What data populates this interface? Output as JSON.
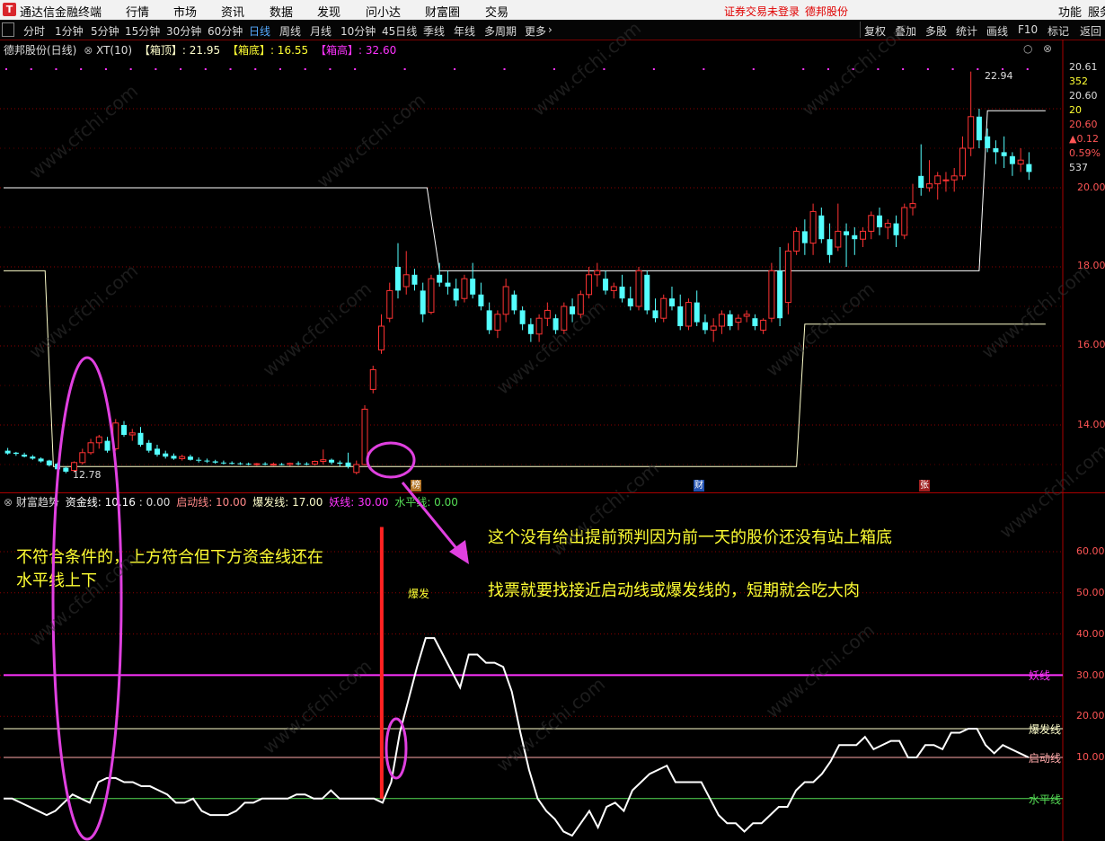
{
  "menu": {
    "app_title": "通达信金融终端",
    "items": [
      "行情",
      "市场",
      "资讯",
      "数据",
      "发现",
      "问小达",
      "财富圈",
      "交易"
    ],
    "login_status": "证券交易未登录",
    "stock_name": "德邦股份",
    "right_items": [
      "功能",
      "服务"
    ]
  },
  "toolbar": {
    "periods": [
      "分时",
      "1分钟",
      "5分钟",
      "15分钟",
      "30分钟",
      "60分钟",
      "日线",
      "周线",
      "月线",
      "10分钟",
      "45日线",
      "季线",
      "年线",
      "多周期",
      "更多"
    ],
    "active_period": "日线",
    "tools": [
      "复权",
      "叠加",
      "多股",
      "统计",
      "画线",
      "F10",
      "标记",
      "返回"
    ]
  },
  "main_panel": {
    "title": "德邦股份(日线)",
    "indicator_name": "XT(10)",
    "box_top_label": "【箱顶】: 21.95",
    "box_bottom_label": "【箱底】: 16.55",
    "box_high_label": "【箱高】: 32.60",
    "low_marker": "12.78",
    "high_marker": "22.94",
    "event_markers": [
      "榜",
      "财",
      "张"
    ],
    "y_axis_ticks": [
      "14.00",
      "16.00",
      "18.00",
      "20.00"
    ],
    "right_readouts": [
      "20.61",
      "352",
      "20.60",
      "20",
      "20.60",
      "▲0.12",
      "0.59%",
      "537"
    ]
  },
  "sub_panel": {
    "title": "财富趋势",
    "money_line_label": "资金线: 10.16",
    "extra_value": ": 0.00",
    "start_line_label": "启动线: 10.00",
    "burst_line_label": "爆发线: 17.00",
    "demon_line_label": "妖线: 30.00",
    "level_line_label": "水平线: 0.00",
    "y_axis_ticks": [
      "10.00",
      "20.00",
      "30.00",
      "40.00",
      "50.00",
      "60.00"
    ],
    "line_tags": {
      "demon": "妖线",
      "burst": "爆发线",
      "start": "启动线",
      "level": "水平线"
    },
    "burst_signal_label": "爆发"
  },
  "annotations": {
    "left_note_line1": "不符合条件的，上方符合但下方资金线还在",
    "left_note_line2": "水平线上下",
    "right_note1": "这个没有给出提前预判因为前一天的股价还没有站上箱底",
    "right_note2": "找票就要找接近启动线或爆发线的，短期就会吃大肉"
  },
  "watermark": "www.cfchi.com",
  "colors": {
    "up": "#ff3333",
    "down": "#54ffff",
    "box_line": "#ffffcc",
    "demon": "#ff33ff",
    "burst": "#ffffcc",
    "start": "#ffaaaa",
    "level": "#55dd55",
    "annot": "#ffff33",
    "ellipse": "#e040e0"
  },
  "chart_data": {
    "type": "candlestick",
    "y_range": [
      12.5,
      21.5
    ],
    "candles": [
      [
        13.35,
        13.42,
        13.25,
        13.28
      ],
      [
        13.3,
        13.32,
        13.22,
        13.27
      ],
      [
        13.25,
        13.3,
        13.18,
        13.2
      ],
      [
        13.2,
        13.24,
        13.12,
        13.15
      ],
      [
        13.15,
        13.18,
        13.05,
        13.08
      ],
      [
        13.1,
        13.12,
        12.95,
        12.98
      ],
      [
        13.02,
        13.05,
        12.85,
        12.88
      ],
      [
        12.92,
        12.95,
        12.78,
        12.82
      ],
      [
        12.85,
        13.08,
        12.8,
        13.05
      ],
      [
        13.05,
        13.4,
        13.0,
        13.3
      ],
      [
        13.3,
        13.65,
        13.25,
        13.55
      ],
      [
        13.55,
        13.75,
        13.4,
        13.7
      ],
      [
        13.6,
        13.7,
        13.3,
        13.35
      ],
      [
        13.4,
        14.15,
        13.35,
        14.05
      ],
      [
        14.0,
        14.1,
        13.7,
        13.75
      ],
      [
        13.75,
        13.9,
        13.6,
        13.8
      ],
      [
        13.8,
        13.95,
        13.45,
        13.5
      ],
      [
        13.55,
        13.62,
        13.3,
        13.35
      ],
      [
        13.4,
        13.5,
        13.2,
        13.25
      ],
      [
        13.28,
        13.35,
        13.15,
        13.2
      ],
      [
        13.22,
        13.28,
        13.12,
        13.15
      ],
      [
        13.15,
        13.25,
        13.1,
        13.2
      ],
      [
        13.2,
        13.25,
        13.1,
        13.12
      ],
      [
        13.12,
        13.18,
        13.05,
        13.1
      ],
      [
        13.1,
        13.15,
        13.04,
        13.08
      ],
      [
        13.08,
        13.12,
        13.02,
        13.05
      ],
      [
        13.05,
        13.1,
        13.0,
        13.04
      ],
      [
        13.04,
        13.08,
        13.0,
        13.03
      ],
      [
        13.03,
        13.06,
        12.99,
        13.02
      ],
      [
        13.02,
        13.05,
        12.98,
        13.0
      ],
      [
        13.0,
        13.04,
        12.97,
        13.02
      ],
      [
        13.02,
        13.06,
        12.98,
        13.0
      ],
      [
        13.0,
        13.05,
        12.97,
        13.01
      ],
      [
        13.01,
        13.04,
        12.98,
        13.0
      ],
      [
        13.0,
        13.05,
        12.96,
        13.03
      ],
      [
        13.03,
        13.08,
        12.98,
        13.02
      ],
      [
        13.02,
        13.06,
        12.98,
        13.01
      ],
      [
        13.01,
        13.1,
        12.98,
        13.08
      ],
      [
        13.08,
        13.38,
        13.0,
        13.12
      ],
      [
        13.12,
        13.15,
        13.0,
        13.05
      ],
      [
        13.05,
        13.1,
        12.95,
        13.02
      ],
      [
        13.05,
        13.3,
        12.9,
        12.95
      ],
      [
        12.8,
        13.1,
        12.75,
        13.0
      ],
      [
        13.0,
        14.5,
        12.98,
        14.4
      ],
      [
        14.9,
        15.5,
        14.8,
        15.4
      ],
      [
        15.9,
        16.8,
        15.8,
        16.5
      ],
      [
        16.7,
        17.6,
        16.6,
        17.4
      ],
      [
        18.0,
        18.6,
        17.2,
        17.4
      ],
      [
        17.5,
        18.4,
        17.3,
        17.8
      ],
      [
        17.8,
        17.95,
        17.4,
        17.55
      ],
      [
        17.4,
        17.6,
        16.6,
        16.8
      ],
      [
        16.85,
        17.8,
        16.8,
        17.7
      ],
      [
        17.8,
        18.1,
        17.5,
        17.6
      ],
      [
        17.6,
        17.9,
        17.3,
        17.5
      ],
      [
        17.45,
        17.7,
        17.0,
        17.15
      ],
      [
        17.2,
        17.8,
        17.1,
        17.7
      ],
      [
        17.7,
        18.1,
        17.2,
        17.3
      ],
      [
        17.3,
        17.6,
        16.9,
        17.0
      ],
      [
        16.9,
        17.1,
        16.3,
        16.4
      ],
      [
        16.4,
        16.9,
        16.2,
        16.8
      ],
      [
        16.8,
        17.7,
        16.6,
        17.5
      ],
      [
        17.3,
        17.4,
        16.8,
        16.9
      ],
      [
        16.9,
        17.0,
        16.4,
        16.55
      ],
      [
        16.55,
        16.7,
        16.1,
        16.3
      ],
      [
        16.3,
        16.8,
        16.1,
        16.7
      ],
      [
        16.7,
        17.1,
        16.5,
        16.9
      ],
      [
        16.7,
        16.8,
        16.3,
        16.4
      ],
      [
        16.4,
        17.1,
        16.3,
        17.0
      ],
      [
        17.0,
        17.2,
        16.6,
        16.8
      ],
      [
        16.8,
        17.4,
        16.7,
        17.3
      ],
      [
        17.3,
        18.0,
        17.2,
        17.8
      ],
      [
        17.8,
        18.1,
        17.5,
        17.9
      ],
      [
        17.7,
        17.9,
        17.3,
        17.4
      ],
      [
        17.4,
        17.6,
        17.2,
        17.5
      ],
      [
        17.5,
        17.8,
        17.1,
        17.2
      ],
      [
        17.2,
        17.5,
        16.9,
        17.0
      ],
      [
        17.0,
        18.0,
        16.9,
        17.9
      ],
      [
        17.8,
        17.9,
        16.8,
        16.9
      ],
      [
        16.9,
        17.2,
        16.6,
        16.7
      ],
      [
        16.7,
        17.3,
        16.6,
        17.2
      ],
      [
        17.2,
        17.5,
        16.9,
        17.0
      ],
      [
        17.0,
        17.3,
        16.4,
        16.5
      ],
      [
        16.5,
        17.2,
        16.4,
        17.1
      ],
      [
        17.1,
        17.4,
        16.5,
        16.6
      ],
      [
        16.6,
        16.8,
        16.3,
        16.4
      ],
      [
        16.4,
        16.7,
        16.1,
        16.5
      ],
      [
        16.5,
        16.9,
        16.3,
        16.8
      ],
      [
        16.8,
        16.9,
        16.4,
        16.5
      ],
      [
        16.6,
        16.8,
        16.4,
        16.7
      ],
      [
        16.75,
        16.9,
        16.6,
        16.8
      ],
      [
        16.7,
        16.8,
        16.4,
        16.5
      ],
      [
        16.4,
        16.7,
        16.3,
        16.65
      ],
      [
        16.7,
        18.1,
        16.6,
        17.9
      ],
      [
        17.9,
        18.5,
        16.5,
        16.7
      ],
      [
        17.1,
        18.6,
        16.8,
        18.4
      ],
      [
        18.4,
        19.0,
        18.3,
        18.9
      ],
      [
        18.9,
        19.2,
        18.3,
        18.6
      ],
      [
        18.6,
        19.6,
        18.3,
        19.4
      ],
      [
        19.3,
        19.5,
        18.6,
        18.7
      ],
      [
        18.7,
        19.1,
        18.1,
        18.3
      ],
      [
        18.5,
        19.6,
        18.4,
        18.9
      ],
      [
        18.9,
        19.1,
        18.0,
        18.8
      ],
      [
        18.8,
        19.0,
        18.3,
        18.7
      ],
      [
        18.7,
        19.0,
        18.5,
        18.9
      ],
      [
        18.9,
        19.4,
        18.7,
        19.3
      ],
      [
        19.3,
        19.5,
        18.8,
        19.0
      ],
      [
        19.0,
        19.2,
        18.7,
        19.1
      ],
      [
        19.1,
        19.3,
        18.5,
        18.8
      ],
      [
        18.8,
        19.6,
        18.7,
        19.5
      ],
      [
        19.5,
        20.1,
        19.3,
        19.6
      ],
      [
        20.3,
        21.1,
        19.8,
        20.0
      ],
      [
        20.0,
        20.7,
        19.9,
        20.1
      ],
      [
        20.1,
        20.4,
        19.7,
        20.3
      ],
      [
        20.2,
        20.4,
        19.9,
        20.2
      ],
      [
        20.2,
        20.5,
        19.9,
        20.3
      ],
      [
        20.3,
        21.3,
        20.2,
        21.0
      ],
      [
        21.0,
        22.94,
        20.8,
        21.8
      ],
      [
        21.8,
        22.0,
        21.0,
        21.2
      ],
      [
        21.3,
        21.5,
        20.9,
        21.0
      ],
      [
        21.0,
        21.2,
        20.6,
        20.9
      ],
      [
        20.9,
        21.3,
        20.5,
        20.8
      ],
      [
        20.8,
        20.9,
        20.3,
        20.6
      ],
      [
        20.6,
        21.0,
        20.4,
        20.7
      ],
      [
        20.6,
        20.9,
        20.2,
        20.4
      ]
    ],
    "box_line": [
      17.9,
      17.9,
      17.9,
      17.9,
      12.95,
      12.95,
      12.95,
      12.95,
      12.95,
      12.95,
      12.95,
      12.95,
      12.95,
      12.95,
      12.95,
      12.95,
      12.95,
      12.95,
      12.95,
      12.95,
      12.95,
      12.95,
      12.95,
      12.95,
      12.95,
      12.95,
      12.95,
      12.95,
      12.95,
      12.95,
      12.95,
      12.95,
      12.95,
      12.95,
      12.95,
      12.95,
      12.95,
      12.95,
      12.95,
      12.95,
      12.95,
      12.95,
      12.95,
      12.95,
      12.95,
      12.95,
      12.95,
      12.95,
      12.95
    ],
    "money_line": [
      0,
      0,
      -1,
      -2,
      -3,
      -4,
      -3,
      -1,
      1,
      0,
      -1,
      4,
      5,
      5,
      4,
      4,
      3,
      3,
      2,
      1,
      -1,
      -1,
      0,
      -3,
      -4,
      -4,
      -4,
      -3,
      -1,
      -1,
      0,
      0,
      0,
      0,
      1,
      1,
      0,
      0,
      2,
      0,
      0,
      0,
      0,
      0,
      -1,
      4,
      16,
      24,
      32,
      39,
      39,
      35,
      31,
      27,
      35,
      35,
      33,
      33,
      32,
      26,
      16,
      7,
      0,
      -3,
      -5,
      -8,
      -9,
      -6,
      -3,
      -7,
      -2,
      -1,
      -3,
      2,
      4,
      6,
      7,
      8,
      4,
      4,
      4,
      4,
      0,
      -4,
      -6,
      -6,
      -8,
      -6,
      -6,
      -4,
      -2,
      -2,
      2,
      4,
      4,
      6,
      9,
      13,
      13,
      13,
      15,
      12,
      13,
      14,
      14,
      10,
      10,
      13,
      13,
      12,
      16,
      16,
      17,
      17,
      13,
      11,
      13,
      12,
      11,
      10
    ],
    "levels": {
      "start": 10,
      "burst": 17,
      "demon": 30,
      "level": 0
    },
    "sub_range": [
      -10,
      68
    ]
  }
}
